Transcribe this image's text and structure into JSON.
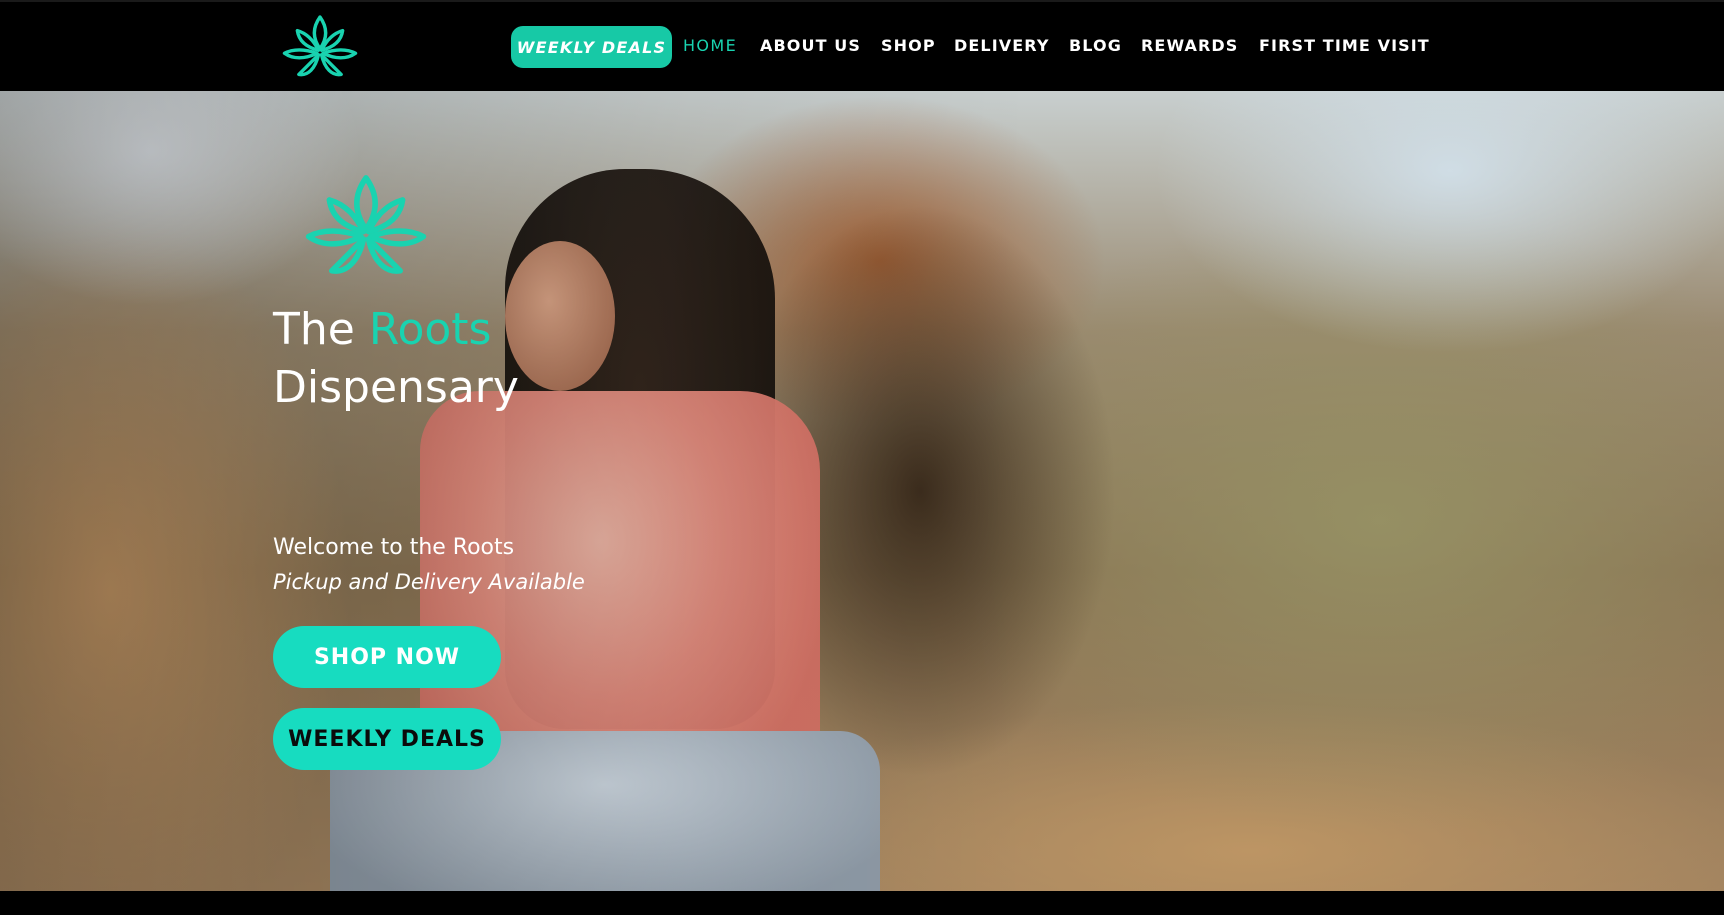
{
  "brand": {
    "logo_icon": "cannabis-leaf-outline-icon",
    "accent_color": "#19d3b0",
    "button_color": "#17dcc0"
  },
  "nav": {
    "weekly_deals": "WEEKLY DEALS",
    "items": [
      {
        "label": "HOME",
        "active": true
      },
      {
        "label": "ABOUT US",
        "active": false
      },
      {
        "label": "SHOP",
        "active": false
      },
      {
        "label": "DELIVERY",
        "active": false
      },
      {
        "label": "BLOG",
        "active": false
      },
      {
        "label": "REWARDS",
        "active": false
      },
      {
        "label": "FIRST TIME VISIT",
        "active": false
      }
    ]
  },
  "hero": {
    "title_part1": "The",
    "title_accent": "Roots",
    "title_part2": "Dispensary",
    "welcome": "Welcome to the Roots",
    "subtitle": "Pickup and Delivery Available",
    "shop_button": "SHOP NOW",
    "deals_button": "WEEKLY DEALS"
  }
}
